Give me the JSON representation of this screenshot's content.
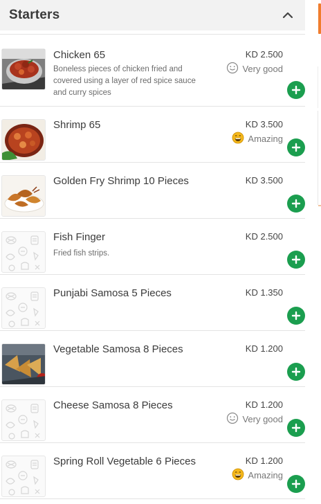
{
  "section": {
    "title": "Starters",
    "collapse_icon": "chevron-up-icon"
  },
  "colors": {
    "add_button": "#1b9e4f",
    "accent": "#f07d2e",
    "emoji_amazing": "#f5b81c"
  },
  "items": [
    {
      "name": "Chicken 65",
      "description": "Boneless pieces of chicken fried and covered using a layer of red spice sauce and curry spices",
      "price": "KD 2.500",
      "rating": "Very good",
      "rating_icon": "smile-outline-icon",
      "image": "food-photo-chicken"
    },
    {
      "name": "Shrimp 65",
      "description": "",
      "price": "KD 3.500",
      "rating": "Amazing",
      "rating_icon": "grin-emoji-icon",
      "image": "food-photo-shrimp-curry"
    },
    {
      "name": "Golden Fry Shrimp 10 Pieces",
      "description": "",
      "price": "KD 3.500",
      "rating": "",
      "image": "food-photo-fried-shrimp"
    },
    {
      "name": "Fish Finger",
      "description": "Fried fish strips.",
      "price": "KD 2.500",
      "rating": "",
      "image": "placeholder-food-pattern"
    },
    {
      "name": "Punjabi Samosa 5 Pieces",
      "description": "",
      "price": "KD 1.350",
      "rating": "",
      "image": "placeholder-food-pattern"
    },
    {
      "name": "Vegetable Samosa 8 Pieces",
      "description": "",
      "price": "KD 1.200",
      "rating": "",
      "image": "food-photo-samosa"
    },
    {
      "name": "Cheese Samosa 8 Pieces",
      "description": "",
      "price": "KD 1.200",
      "rating": "Very good",
      "rating_icon": "smile-outline-icon",
      "image": "placeholder-food-pattern"
    },
    {
      "name": "Spring Roll Vegetable 6 Pieces",
      "description": "",
      "price": "KD 1.200",
      "rating": "Amazing",
      "rating_icon": "grin-emoji-icon",
      "image": "placeholder-food-pattern"
    }
  ]
}
